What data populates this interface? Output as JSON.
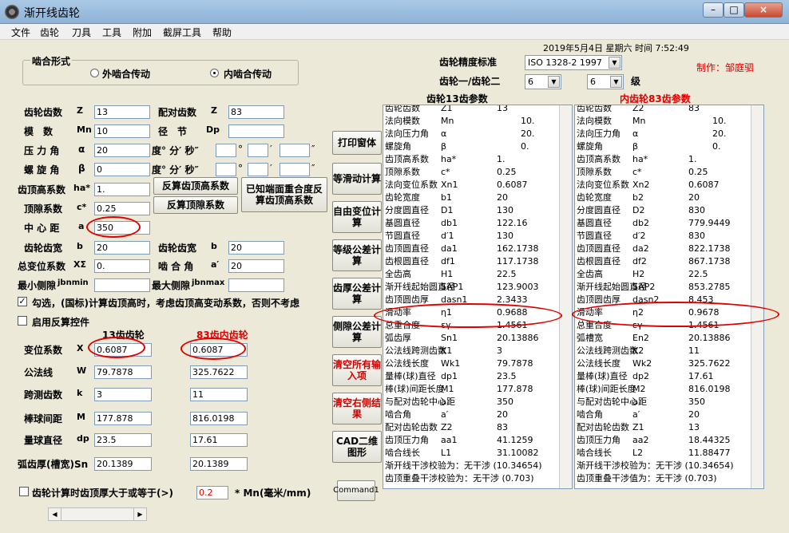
{
  "window": {
    "title": "渐开线齿轮",
    "min": "–",
    "max": "□",
    "close": "×"
  },
  "menu": [
    "文件",
    "齿轮",
    "刀具",
    "工具",
    "附加",
    "截屏工具",
    "帮助"
  ],
  "clock": "2019年5月4日 星期六 时间 7:52:49",
  "author": "制作：邹庭驷",
  "mesh": {
    "title": "啮合形式",
    "external": "外啮合传动",
    "internal": "内啮合传动"
  },
  "precision": {
    "label": "齿轮精度标准",
    "value": "ISO 1328-2 1997",
    "pair_label": "齿轮一/齿轮二",
    "grade1": "6",
    "grade2": "6",
    "grade_unit": "级"
  },
  "params": {
    "teeth_label": "齿轮齿数",
    "teeth_sym": "Z",
    "teeth1": "13",
    "mating_teeth_label": "配对齿数",
    "mating_teeth_sym": "Z",
    "mating_teeth": "83",
    "module_label": "模　数",
    "module_sym": "Mn",
    "module": "10",
    "pitch_label": "径　节",
    "pitch_sym": "Dp",
    "pitch": "",
    "pressure_label": "压 力 角",
    "pressure_sym": "α",
    "pressure": "20",
    "dms_label": "度° 分′ 秒″",
    "deg": "°",
    "min": "′",
    "sec": "″",
    "helix_label": "螺 旋 角",
    "helix_sym": "β",
    "helix": "0",
    "addendum_label": "齿顶高系数",
    "addendum_sym": "ha*",
    "addendum": "1.",
    "clearance_label": "顶隙系数",
    "clearance_sym": "c*",
    "clearance": "0.25",
    "center_label": "中 心 距",
    "center_sym": "a",
    "center": "350",
    "width_label": "齿轮齿宽",
    "width_sym": "b",
    "width1": "20",
    "width2_label": "齿轮齿宽",
    "width2_sym": "b",
    "width2": "20",
    "total_shift_label": "总变位系数",
    "total_shift_sym": "XΣ",
    "total_shift": "0.",
    "mesh_angle_label": "啮 合 角",
    "mesh_angle_sym": "a′",
    "mesh_angle": "20",
    "min_bl_label": "最小侧隙",
    "min_bl_sym": "jbnmin",
    "max_bl_label": "最大侧隙",
    "max_bl_sym": "jbnmax"
  },
  "btns": {
    "rev_addendum": "反算齿顶高系数",
    "rev_clearance": "反算顶隙系数",
    "known_end": "已知端面重合度反算齿顶高系数",
    "print": "打印窗体",
    "equal_slide": "等滑动计算",
    "free_shift": "自由变位计算",
    "equal_tol": "等级公差计算",
    "thick_tol": "齿厚公差计算",
    "side_tol": "侧隙公差计算",
    "clear_all": "清空所有输入项",
    "clear_right": "清空右侧结果",
    "cad": "CAD二维图形",
    "command": "Command1"
  },
  "check_std": "勾选，(国标)计算齿顶高时，考虑齿顶高变动系数，否则不考虑",
  "check_rev": "启用反算控件",
  "lower": {
    "head1": "13齿齿轮",
    "head2": "83齿内齿轮",
    "shift_label": "变位系数",
    "shift_sym": "X",
    "shift1": "0.6087",
    "shift2": "0.6087",
    "normal_label": "公法线",
    "normal_sym": "W",
    "normal1": "79.7878",
    "normal2": "325.7622",
    "span_label": "跨测齿数",
    "span_sym": "k",
    "span1": "3",
    "span2": "11",
    "rod_label": "棒球间距",
    "rod_sym": "M",
    "rod1": "177.878",
    "rod2": "816.0198",
    "ball_label": "量球直径",
    "ball_sym": "dp",
    "ball1": "23.5",
    "ball2": "17.61",
    "arc_label": "弧齿厚(槽宽)Sn",
    "arc1": "20.1389",
    "arc2": "20.1389"
  },
  "bottom_check": {
    "label": "齿轮计算时齿顶厚大于或等于(>)",
    "value": "0.2",
    "unit": "* Mn(毫米/mm)"
  },
  "panel1": {
    "title": "齿轮13齿参数",
    "rows": [
      [
        "齿轮齿数",
        "Z1",
        "13"
      ],
      [
        "法向模数",
        "Mn",
        "10."
      ],
      [
        "法向压力角",
        "α",
        "20."
      ],
      [
        "螺旋角",
        "β",
        "0."
      ],
      [
        "齿顶高系数",
        "ha*",
        "1."
      ],
      [
        "顶隙系数",
        "c*",
        "0.25"
      ],
      [
        "法向变位系数",
        "Xn1",
        "0.6087"
      ],
      [
        "齿轮宽度",
        "b1",
        "20"
      ],
      [
        "分度圆直径",
        "D1",
        "130"
      ],
      [
        "基圆直径",
        "db1",
        "122.16"
      ],
      [
        "节圆直径",
        "d′1",
        "130"
      ],
      [
        "齿顶圆直径",
        "da1",
        "162.1738"
      ],
      [
        "齿根圆直径",
        "df1",
        "117.1738"
      ],
      [
        "全齿高",
        "H1",
        "22.5"
      ],
      [
        "渐开线起始圆直径",
        "SAP1",
        "123.9003"
      ],
      [
        "齿顶圆齿厚",
        "dasn1",
        "2.3433"
      ],
      [
        "滑动率",
        "η1",
        "0.9688"
      ],
      [
        "总重合度",
        "εγ",
        "1.4561"
      ],
      [
        "弧齿厚",
        "Sn1",
        "20.13886"
      ],
      [
        "公法线跨测齿数",
        "K1",
        "3"
      ],
      [
        "公法线长度",
        "Wk1",
        "79.7878"
      ],
      [
        "量棒(球)直径",
        "dp1",
        "23.5"
      ],
      [
        "棒(球)间距长度",
        "M1",
        "177.878"
      ],
      [
        "与配对齿轮中心距",
        "a",
        "350"
      ],
      [
        "啮合角",
        "a′",
        "20"
      ],
      [
        "配对齿轮齿数",
        "Z2",
        "83"
      ],
      [
        "齿顶压力角",
        "aa1",
        "41.1259"
      ],
      [
        "啮合线长",
        "L1",
        "31.10082"
      ]
    ],
    "interference": "渐开线干涉校验为：无干涉 (10.34654)",
    "overlap": "齿顶重叠干涉校验为：无干涉 (0.703)"
  },
  "panel2": {
    "title": "内齿轮83齿参数",
    "rows": [
      [
        "齿轮齿数",
        "Z2",
        "83"
      ],
      [
        "法向模数",
        "Mn",
        "10."
      ],
      [
        "法向压力角",
        "α",
        "20."
      ],
      [
        "螺旋角",
        "β",
        "0."
      ],
      [
        "齿顶高系数",
        "ha*",
        "1."
      ],
      [
        "顶隙系数",
        "c*",
        "0.25"
      ],
      [
        "法向变位系数",
        "Xn2",
        "0.6087"
      ],
      [
        "齿轮宽度",
        "b2",
        "20"
      ],
      [
        "分度圆直径",
        "D2",
        "830"
      ],
      [
        "基圆直径",
        "db2",
        "779.9449"
      ],
      [
        "节圆直径",
        "d′2",
        "830"
      ],
      [
        "齿顶圆直径",
        "da2",
        "822.1738"
      ],
      [
        "齿根圆直径",
        "df2",
        "867.1738"
      ],
      [
        "全齿高",
        "H2",
        "22.5"
      ],
      [
        "渐开线起始圆直径",
        "SAP2",
        "853.2785"
      ],
      [
        "齿顶圆齿厚",
        "dasn2",
        "8.453"
      ],
      [
        "滑动率",
        "η2",
        "0.9678"
      ],
      [
        "总重合度",
        "εγ",
        "1.4561"
      ],
      [
        "弧槽宽",
        "En2",
        "20.13886"
      ],
      [
        "公法线跨测齿数",
        "K2",
        "11"
      ],
      [
        "公法线长度",
        "Wk2",
        "325.7622"
      ],
      [
        "量棒(球)直径",
        "dp2",
        "17.61"
      ],
      [
        "棒(球)间距长度",
        "M2",
        "816.0198"
      ],
      [
        "与配对齿轮中心距",
        "a",
        "350"
      ],
      [
        "啮合角",
        "a′",
        "20"
      ],
      [
        "配对齿轮齿数",
        "Z1",
        "13"
      ],
      [
        "齿顶压力角",
        "aa2",
        "18.44325"
      ],
      [
        "啮合线长",
        "L2",
        "11.88477"
      ]
    ],
    "interference": "渐开线干涉校验为：无干涉 (10.34654)",
    "overlap": "齿顶重叠干涉值为：无干涉 (0.703)"
  }
}
